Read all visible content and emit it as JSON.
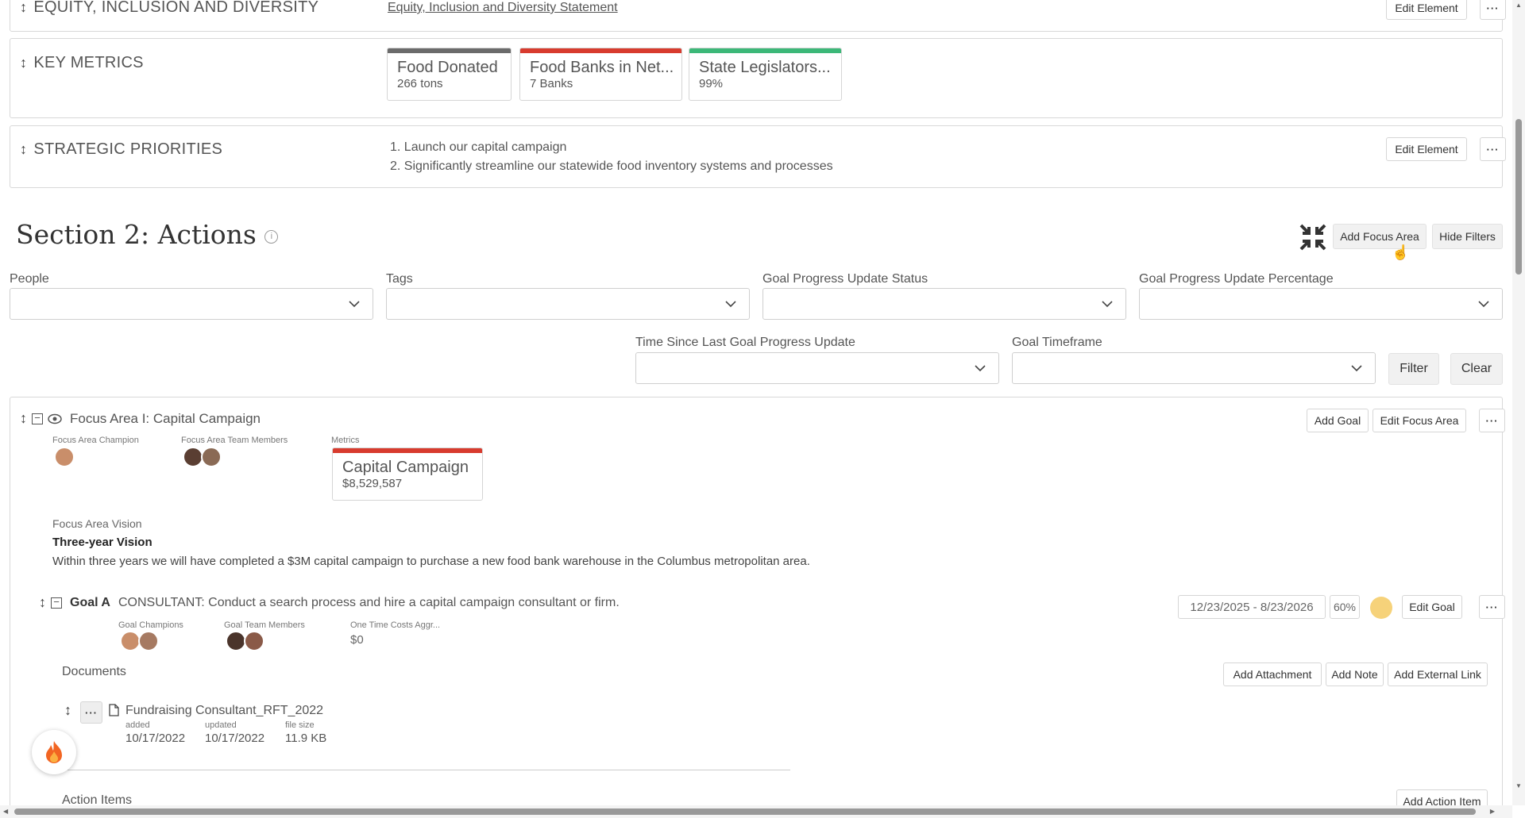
{
  "top_panels": {
    "equity": {
      "title": "EQUITY, INCLUSION AND DIVERSITY",
      "link": "Equity, Inclusion and Diversity Statement",
      "edit_label": "Edit Element",
      "more_label": "···"
    },
    "key_metrics": {
      "title": "KEY METRICS",
      "cards": [
        {
          "name": "Food Donated",
          "value": "266 tons",
          "color": "#6b6b6b"
        },
        {
          "name": "Food Banks in Net...",
          "value": "7 Banks",
          "color": "#d83b2e"
        },
        {
          "name": "State Legislators...",
          "value": "99%",
          "color": "#3cb878"
        }
      ]
    },
    "strategic": {
      "title": "STRATEGIC PRIORITIES",
      "items": [
        "1. Launch our capital campaign",
        "2. Significantly streamline our statewide food inventory systems and processes"
      ],
      "edit_label": "Edit Element",
      "more_label": "···"
    }
  },
  "section": {
    "title": "Section 2: Actions",
    "add_focus_area": "Add Focus Area",
    "hide_filters": "Hide Filters"
  },
  "filters": {
    "people": "People",
    "tags": "Tags",
    "status": "Goal Progress Update Status",
    "percentage": "Goal Progress Update Percentage",
    "time_since": "Time Since Last Goal Progress Update",
    "timeframe": "Goal Timeframe",
    "filter_btn": "Filter",
    "clear_btn": "Clear"
  },
  "focus_area": {
    "title": "Focus Area I: Capital Campaign",
    "add_goal": "Add Goal",
    "edit_focus_area": "Edit Focus Area",
    "more_label": "···",
    "champion_label": "Focus Area Champion",
    "team_label": "Focus Area Team Members",
    "metrics_label": "Metrics",
    "metric": {
      "name": "Capital Campaign",
      "value": "$8,529,587",
      "color": "#d83b2e"
    },
    "vision_label": "Focus Area Vision",
    "vision_title": "Three-year Vision",
    "vision_text": "Within three years we will have completed a $3M capital campaign to purchase a new food bank warehouse in the Columbus metropolitan area."
  },
  "goal": {
    "label": "Goal A",
    "text": "CONSULTANT: Conduct a search process and hire a capital campaign consultant or firm.",
    "dates": "12/23/2025 - 8/23/2026",
    "percent": "60%",
    "status_color": "#f6d27a",
    "edit_goal": "Edit Goal",
    "more_label": "···",
    "champions_label": "Goal Champions",
    "team_label": "Goal Team Members",
    "costs_label": "One Time Costs Aggr...",
    "costs_value": "$0"
  },
  "documents": {
    "title": "Documents",
    "add_attachment": "Add Attachment",
    "add_note": "Add Note",
    "add_external_link": "Add External Link",
    "file": {
      "name": "Fundraising Consultant_RFT_2022",
      "added_label": "added",
      "added": "10/17/2022",
      "updated_label": "updated",
      "updated": "10/17/2022",
      "size_label": "file size",
      "size": "11.9 KB"
    },
    "more_label": "···"
  },
  "action_items": {
    "title": "Action Items",
    "add_action_item": "Add Action Item"
  },
  "colors": {
    "accent_dark": "#333333",
    "border": "#d8d8d8"
  }
}
